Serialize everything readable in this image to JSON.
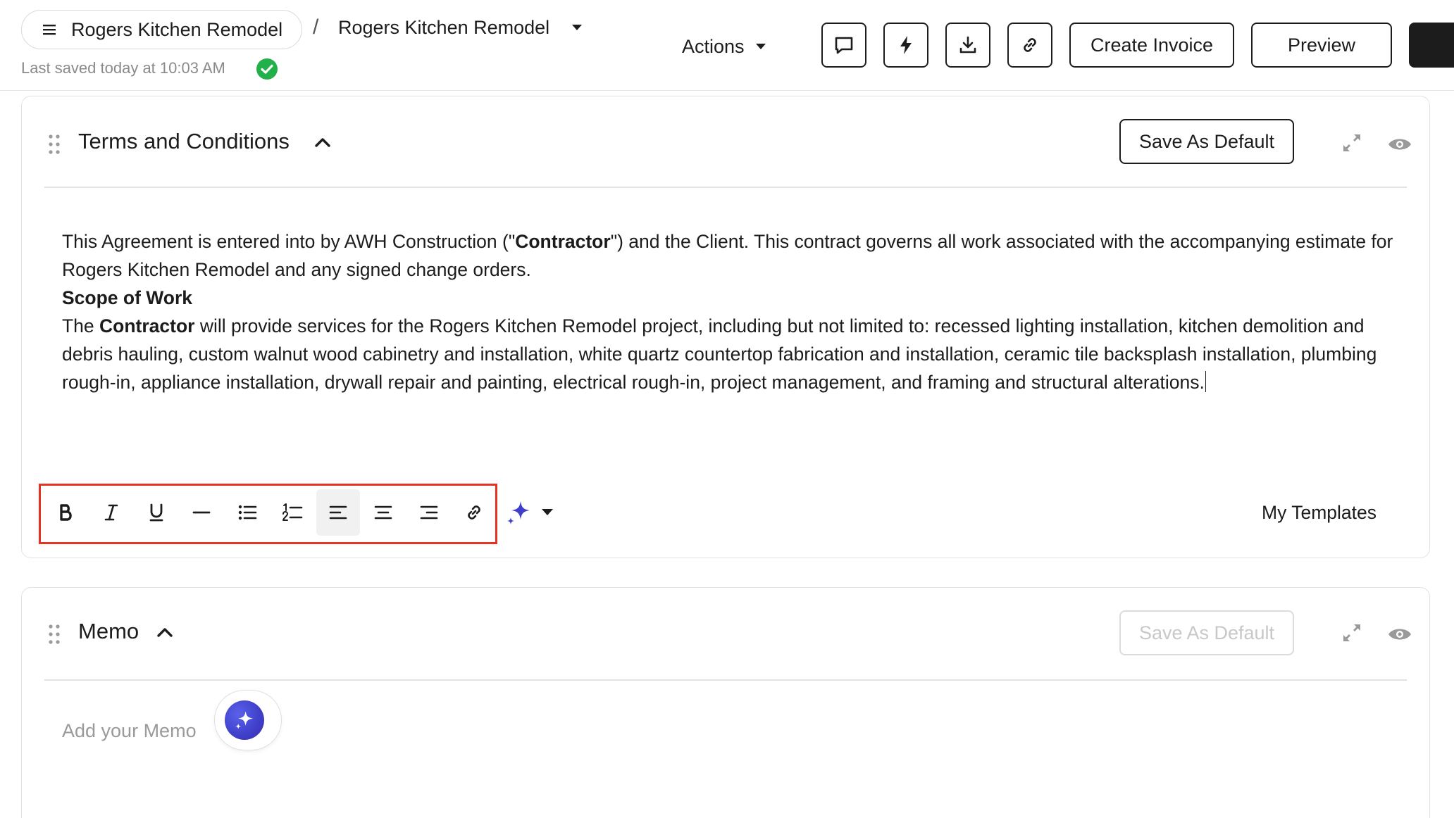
{
  "header": {
    "project_pill_label": "Rogers Kitchen Remodel",
    "breadcrumb_separator": "/",
    "breadcrumb_title": "Rogers Kitchen Remodel",
    "last_saved": "Last saved today at 10:03 AM",
    "actions_label": "Actions",
    "create_invoice_label": "Create Invoice",
    "preview_label": "Preview"
  },
  "terms": {
    "title": "Terms and Conditions",
    "save_default_label": "Save As Default",
    "body": {
      "p1_a": "This Agreement is entered into by AWH Construction (\"",
      "p1_b": "Contractor",
      "p1_c": "\") and the Client. This contract governs all work associated with the accompanying estimate for Rogers Kitchen Remodel and any signed change orders.",
      "heading": "Scope of Work",
      "p2_a": "The ",
      "p2_b": "Contractor",
      "p2_c": " will provide services for the Rogers Kitchen Remodel project, including but not limited to: recessed lighting installation, kitchen demolition and debris hauling, custom walnut wood cabinetry and installation, white quartz countertop fabrication and installation, ceramic tile backsplash installation, plumbing rough-in, appliance installation, drywall repair and painting, electrical rough-in, project management, and framing and structural alterations."
    },
    "my_templates_label": "My Templates"
  },
  "memo": {
    "title": "Memo",
    "save_default_label": "Save As Default",
    "placeholder": "Add your Memo"
  },
  "colors": {
    "text": "#1c1c1c",
    "success": "#22b04b",
    "highlight": "#e53222",
    "ai": "#3f3fc9"
  }
}
